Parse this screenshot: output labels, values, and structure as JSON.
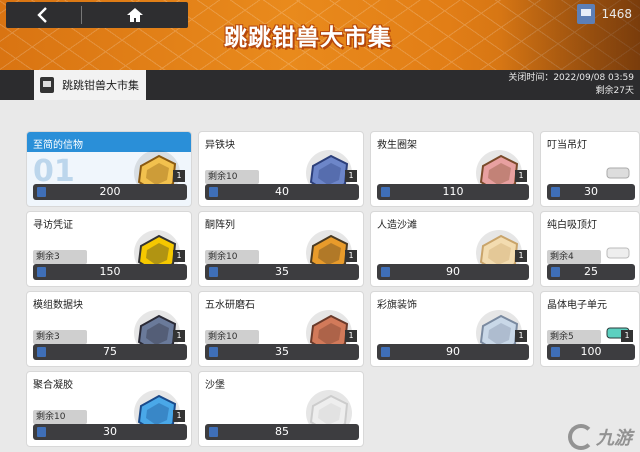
{
  "header": {
    "title": "跳跳钳兽大市集",
    "currency_value": "1468"
  },
  "subbar": {
    "tab_label": "跳跳钳兽大市集",
    "close_time": "关闭时间：2022/09/08 03:59",
    "remaining_days": "剩余27天"
  },
  "colors": {
    "accent_orange": "#e4801a",
    "featured_blue": "#2a8fd8",
    "price_bar": "#3d3d40"
  },
  "items": [
    {
      "name": "至简的信物",
      "big_number": "01",
      "remain": "",
      "price": "200",
      "qty": "1",
      "featured": true,
      "icon": "star-medal-icon"
    },
    {
      "name": "异铁块",
      "remain": "剩余10",
      "price": "40",
      "qty": "1",
      "icon": "crystal-icon"
    },
    {
      "name": "救生圈架",
      "remain": "",
      "price": "110",
      "qty": "1",
      "icon": "lifebuoy-rack-icon"
    },
    {
      "name": "叮当吊灯",
      "remain": "",
      "price": "30",
      "qty": "",
      "icon": "lamp-icon"
    },
    {
      "name": "寻访凭证",
      "remain": "剩余3",
      "price": "150",
      "qty": "1",
      "icon": "permit-card-icon"
    },
    {
      "name": "酮阵列",
      "remain": "剩余10",
      "price": "35",
      "qty": "1",
      "icon": "box-icon"
    },
    {
      "name": "人造沙滩",
      "remain": "",
      "price": "90",
      "qty": "1",
      "icon": "sand-tile-icon"
    },
    {
      "name": "纯白吸顶灯",
      "remain": "剩余4",
      "price": "25",
      "qty": "",
      "icon": "ceiling-lamp-icon"
    },
    {
      "name": "模组数据块",
      "remain": "剩余3",
      "price": "75",
      "qty": "1",
      "icon": "data-block-icon"
    },
    {
      "name": "五水研磨石",
      "remain": "剩余10",
      "price": "35",
      "qty": "1",
      "icon": "grindstone-icon"
    },
    {
      "name": "彩旗装饰",
      "remain": "",
      "price": "90",
      "qty": "1",
      "icon": "bunting-icon"
    },
    {
      "name": "晶体电子单元",
      "remain": "剩余5",
      "price": "100",
      "qty": "1",
      "icon": "crystal-unit-icon"
    },
    {
      "name": "聚合凝胶",
      "remain": "剩余10",
      "price": "30",
      "qty": "1",
      "icon": "gel-icon"
    },
    {
      "name": "沙堡",
      "remain": "",
      "price": "85",
      "qty": "",
      "icon": "sandcastle-icon"
    }
  ],
  "watermark": {
    "text": "九游"
  }
}
